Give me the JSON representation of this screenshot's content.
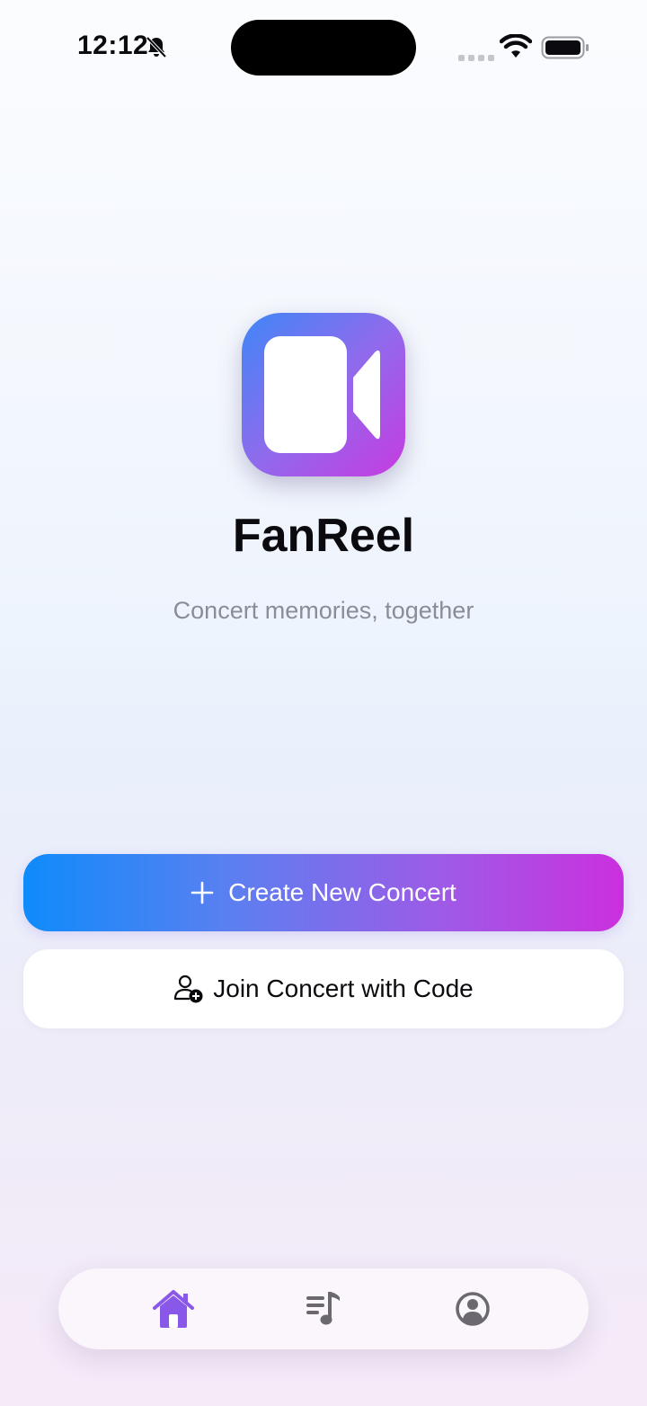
{
  "status_bar": {
    "time": "12:12",
    "icons": [
      "bell-slash-icon",
      "cellular-signal-icon",
      "wifi-icon",
      "battery-icon"
    ]
  },
  "app": {
    "icon": "video-camera-icon",
    "name": "FanReel",
    "tagline": "Concert memories, together"
  },
  "actions": {
    "create_label": "Create New Concert",
    "create_icon": "plus-icon",
    "join_label": "Join Concert with Code",
    "join_icon": "person-add-icon"
  },
  "tab_bar": {
    "tabs": [
      {
        "icon": "home-icon",
        "active": true
      },
      {
        "icon": "music-list-icon",
        "active": false
      },
      {
        "icon": "profile-icon",
        "active": false
      }
    ]
  },
  "colors": {
    "accent_blue": "#0f8bfb",
    "accent_magenta": "#cb30de",
    "active_tab": "#8a58e8",
    "inactive_tab": "#6b6870",
    "tagline": "#8a8d95"
  }
}
